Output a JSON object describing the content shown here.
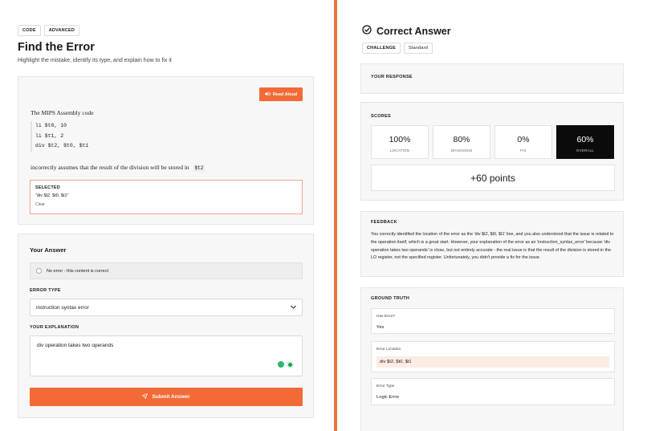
{
  "left": {
    "tags": [
      "CODE",
      "ADVANCED"
    ],
    "title": "Find the Error",
    "subtitle": "Highlight the mistake, identify its type, and explain how to fix it",
    "problem": {
      "read_aloud": "Read Aloud",
      "intro": "The MIPS Assembly code",
      "code_lines": [
        "li $t0, 10",
        "li $t1, 2",
        "div $t2, $t0, $t1"
      ],
      "outro": "incorrectly assumes that the result of the division will be stored in",
      "outro_code": "$t2",
      "selected_label": "SELECTED",
      "selected_value": "\"div $t2, $t0, $t1\"",
      "clear": "Clear"
    },
    "answer": {
      "title": "Your Answer",
      "no_error": "No error - this content is correct",
      "error_type_label": "ERROR TYPE",
      "error_type_value": "instruction syntax error",
      "explanation_label": "YOUR EXPLANATION",
      "explanation_value": "div operation takes two operands",
      "submit": "Submit Answer"
    }
  },
  "right": {
    "title": "Correct Answer",
    "tags": [
      "CHALLENGE",
      "Standard"
    ],
    "your_response_label": "YOUR RESPONSE",
    "scores_label": "SCORES",
    "scores": [
      {
        "value": "100%",
        "name": "LOCATION"
      },
      {
        "value": "80%",
        "name": "DIAGNOSIS"
      },
      {
        "value": "0%",
        "name": "FIX"
      },
      {
        "value": "60%",
        "name": "OVERALL"
      }
    ],
    "points": "+60 points",
    "feedback_label": "FEEDBACK",
    "feedback": "You correctly identified the location of the error as the 'div $t2, $t0, $t1' line, and you also understood that the issue is related to the operation itself, which is a great start. However, your explanation of the error as an 'instruction_syntax_error' because 'div operation takes two operands' is close, but not entirely accurate - the real issue is that the result of the division is stored in the LO register, not the specified register. Unfortunately, you didn't provide a fix for the issue.",
    "ground_truth_label": "GROUND TRUTH",
    "ground_truth": {
      "has_error_key": "Has Error?",
      "has_error_val": "Yes",
      "location_key": "Error Location",
      "location_val": "div $t2, $t0, $t1",
      "type_key": "Error Type",
      "type_val": "Logic Error"
    }
  },
  "colors": {
    "accent": "#f26b37",
    "divider": "#e8753a",
    "dark": "#0b0b0b"
  }
}
